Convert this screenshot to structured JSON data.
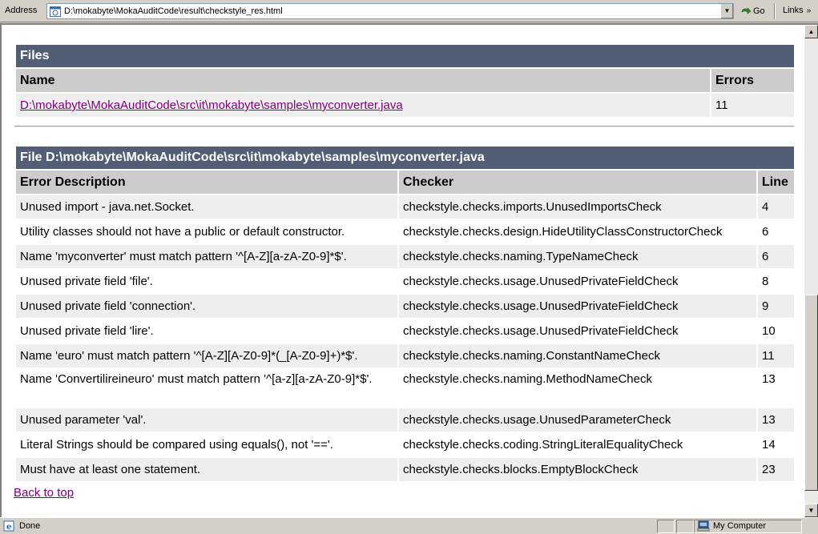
{
  "address_bar": {
    "label": "Address",
    "url": "D:\\mokabyte\\MokaAuditCode\\result\\checkstyle_res.html",
    "go_label": "Go",
    "links_label": "Links"
  },
  "files": {
    "title": "Files",
    "col_name": "Name",
    "col_errors": "Errors",
    "rows": [
      {
        "name": "D:\\mokabyte\\MokaAuditCode\\src\\it\\mokabyte\\samples\\myconverter.java",
        "errors": "11"
      }
    ]
  },
  "file_detail": {
    "title": "File D:\\mokabyte\\MokaAuditCode\\src\\it\\mokabyte\\samples\\myconverter.java",
    "col_desc": "Error Description",
    "col_checker": "Checker",
    "col_line": "Line",
    "rows": [
      {
        "desc": "Unused import - java.net.Socket.",
        "checker": "checkstyle.checks.imports.UnusedImportsCheck",
        "line": "4"
      },
      {
        "desc": "Utility classes should not have a public or default constructor.",
        "checker": "checkstyle.checks.design.HideUtilityClassConstructorCheck",
        "line": "6"
      },
      {
        "desc": "Name 'myconverter' must match pattern '^[A-Z][a-zA-Z0-9]*$'.",
        "checker": "checkstyle.checks.naming.TypeNameCheck",
        "line": "6"
      },
      {
        "desc": "Unused private field 'file'.",
        "checker": "checkstyle.checks.usage.UnusedPrivateFieldCheck",
        "line": "8"
      },
      {
        "desc": "Unused private field 'connection'.",
        "checker": "checkstyle.checks.usage.UnusedPrivateFieldCheck",
        "line": "9"
      },
      {
        "desc": "Unused private field 'lire'.",
        "checker": "checkstyle.checks.usage.UnusedPrivateFieldCheck",
        "line": "10"
      },
      {
        "desc": "Name 'euro' must match pattern '^[A-Z][A-Z0-9]*(_[A-Z0-9]+)*$'.",
        "checker": "checkstyle.checks.naming.ConstantNameCheck",
        "line": "11"
      },
      {
        "desc": "Name 'Convertilireineuro' must match pattern '^[a-z][a-zA-Z0-9]*$'.",
        "checker": "checkstyle.checks.naming.MethodNameCheck",
        "line": "13"
      },
      {
        "desc": "Unused parameter 'val'.",
        "checker": "checkstyle.checks.usage.UnusedParameterCheck",
        "line": "13"
      },
      {
        "desc": "Literal Strings should be compared using equals(), not '=='.",
        "checker": "checkstyle.checks.coding.StringLiteralEqualityCheck",
        "line": "14"
      },
      {
        "desc": "Must have at least one statement.",
        "checker": "checkstyle.checks.blocks.EmptyBlockCheck",
        "line": "23"
      }
    ]
  },
  "back_to_top": "Back to top",
  "status_bar": {
    "status": "Done",
    "zone": "My Computer"
  }
}
